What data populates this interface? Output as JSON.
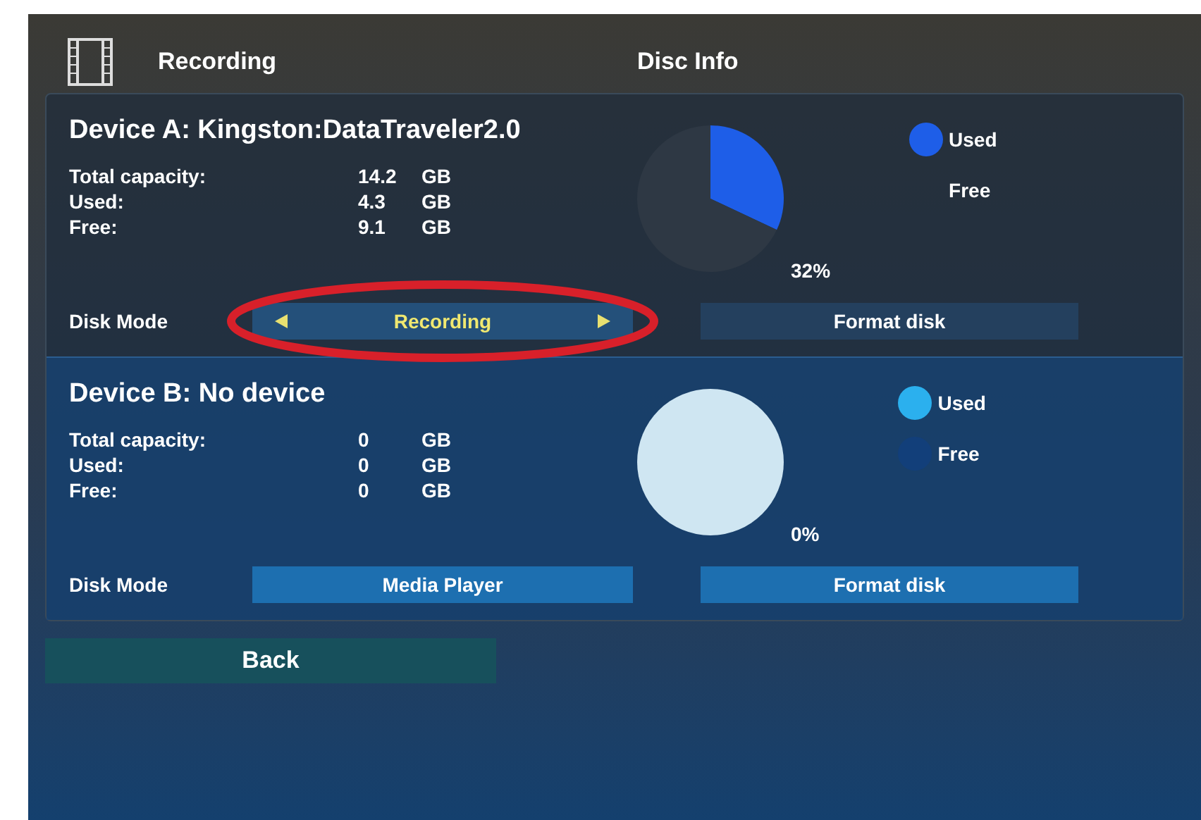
{
  "header": {
    "title": "Recording",
    "section": "Disc Info"
  },
  "devices": [
    {
      "title": "Device A: Kingston:DataTraveler2.0",
      "stats": [
        {
          "label": "Total capacity:",
          "value": "14.2",
          "unit": "GB"
        },
        {
          "label": "Used:",
          "value": "4.3",
          "unit": "GB"
        },
        {
          "label": "Free:",
          "value": "9.1",
          "unit": "GB"
        }
      ],
      "chart_data": {
        "type": "pie",
        "values": [
          32,
          68
        ],
        "annotations": [
          "32%"
        ]
      },
      "legend": [
        {
          "label": "Used",
          "color": "#1e5ee8"
        },
        {
          "label": "Free"
        }
      ],
      "mode_label": "Disk Mode",
      "mode": {
        "value": "Recording",
        "focused": true,
        "annotated": true
      },
      "format_button": "Format disk"
    },
    {
      "title": "Device B: No device",
      "stats": [
        {
          "label": "Total capacity:",
          "value": "0",
          "unit": "GB"
        },
        {
          "label": "Used:",
          "value": "0",
          "unit": "GB"
        },
        {
          "label": "Free:",
          "value": "0",
          "unit": "GB"
        }
      ],
      "chart_data": {
        "type": "pie",
        "values": [
          0,
          100
        ],
        "annotations": [
          "0%"
        ]
      },
      "legend": [
        {
          "label": "Used",
          "color": "#2bb0ee"
        },
        {
          "label": "Free",
          "color": "#123f7a"
        }
      ],
      "mode_label": "Disk Mode",
      "mode": {
        "value": "Media Player",
        "focused": false
      },
      "format_button": "Format disk"
    }
  ],
  "back_button": "Back"
}
